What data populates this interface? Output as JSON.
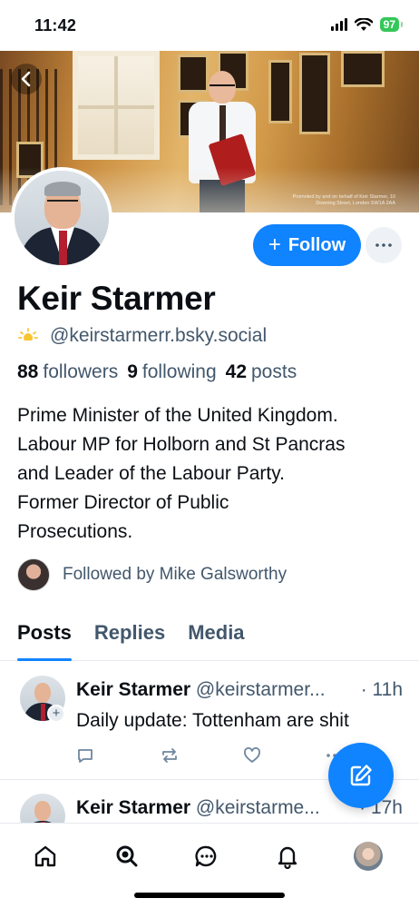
{
  "status_bar": {
    "time": "11:42",
    "battery": "97",
    "icons": [
      "signal-icon",
      "wifi-icon",
      "battery-icon"
    ]
  },
  "banner": {
    "credit": "Promoted by and on behalf of Keir Starmer, 10 Downing Street, London SW1A 2AA"
  },
  "profile": {
    "display_name": "Keir Starmer",
    "handle": "@keirstarmerr.bsky.social",
    "stats": {
      "followers_count": "88",
      "followers_label": "followers",
      "following_count": "9",
      "following_label": "following",
      "posts_count": "42",
      "posts_label": "posts"
    },
    "bio": "Prime Minister of the United Kingdom.\nLabour MP for Holborn and St Pancras\nand Leader of the Labour Party.\nFormer Director of Public\nProsecutions.",
    "followed_by": "Followed by Mike Galsworthy"
  },
  "actions": {
    "follow_label": "Follow",
    "more_icon": "ellipsis-icon"
  },
  "tabs": [
    {
      "label": "Posts",
      "active": true
    },
    {
      "label": "Replies",
      "active": false
    },
    {
      "label": "Media",
      "active": false
    }
  ],
  "posts": [
    {
      "author": "Keir Starmer",
      "handle": "@keirstarmer...",
      "time": "· 11h",
      "text": "Daily update: Tottenham are shit"
    },
    {
      "author": "Keir Starmer",
      "handle": "@keirstarme...",
      "time": "· 17h",
      "text": ""
    }
  ],
  "nav": [
    "home-icon",
    "search-icon",
    "chat-icon",
    "bell-icon",
    "profile-avatar"
  ],
  "colors": {
    "accent": "#1083fe",
    "muted_text": "#42576c",
    "text": "#0b0f14"
  }
}
